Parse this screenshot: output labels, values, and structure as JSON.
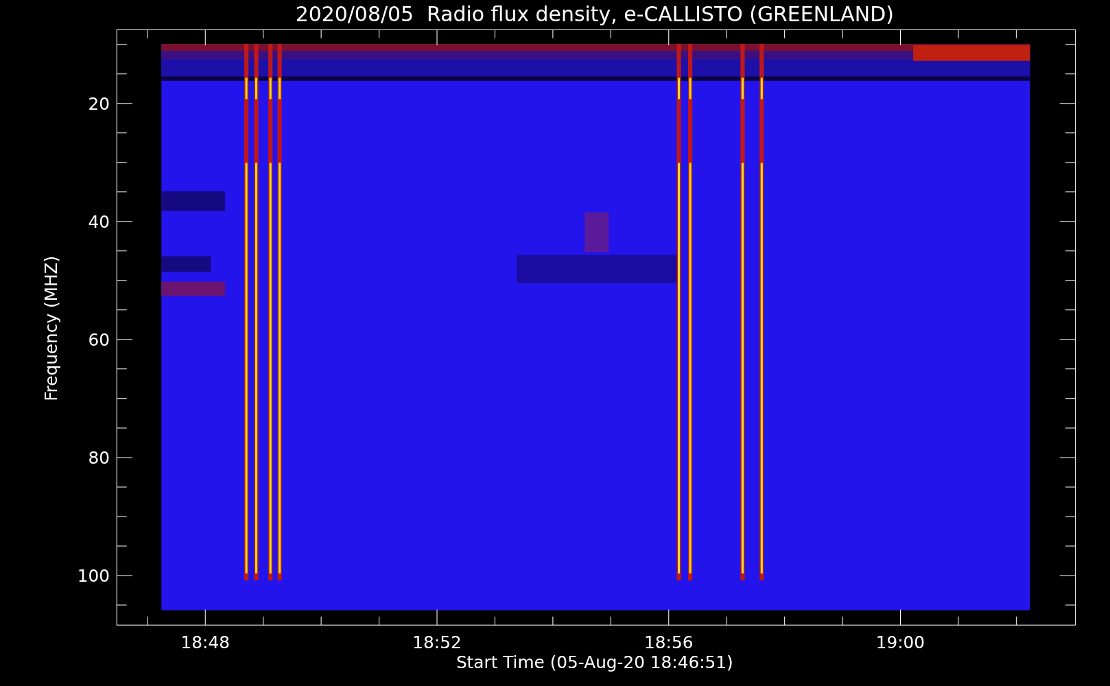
{
  "chart": {
    "title": "2020/08/05  Radio flux density, e-CALLISTO (GREENLAND)",
    "ylabel": "Frequency (MHZ)",
    "xlabel": "Start Time (05-Aug-20 18:46:51)",
    "yticks": [
      "20",
      "40",
      "60",
      "80",
      "100"
    ],
    "xticks": [
      "18:48",
      "18:52",
      "18:56",
      "19:00"
    ]
  }
}
